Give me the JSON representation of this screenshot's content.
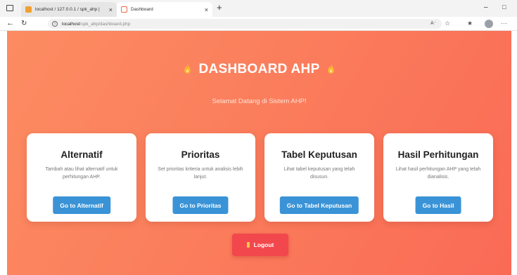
{
  "browser": {
    "tabs": [
      {
        "title": "localhost / 127.0.0.1 / spk_ahp | ",
        "active": false
      },
      {
        "title": "Dashboard",
        "active": true
      }
    ],
    "url_host": "localhost",
    "url_path": "/spk_ahp/dashboard.php",
    "new_tab_symbol": "+",
    "close_symbol": "×",
    "minimize_symbol": "–",
    "menu_symbol": "···"
  },
  "page": {
    "title": "DASHBOARD AHP",
    "subtitle": "Selamat Datang di Sistem AHP!",
    "cards": [
      {
        "title": "Alternatif",
        "desc": "Tambah atau lihat alternatif untuk perhitungan AHP.",
        "button": "Go to Alternatif"
      },
      {
        "title": "Prioritas",
        "desc": "Set prioritas kriteria untuk analisis lebih lanjut.",
        "button": "Go to Prioritas"
      },
      {
        "title": "Tabel Keputusan",
        "desc": "Lihat tabel keputusan yang telah disusun.",
        "button": "Go to Tabel Keputusan"
      },
      {
        "title": "Hasil Perhitungan",
        "desc": "Lihat hasil perhitungan AHP yang telah dianalisis.",
        "button": "Go to Hasil"
      }
    ],
    "logout_label": "Logout"
  },
  "colors": {
    "background_gradient": [
      "#fc8c62",
      "#fa6a56"
    ],
    "card_button": "#3a93d6",
    "logout_button": "#f2474c",
    "flame": "#f7b733"
  },
  "icons": [
    "window-icon",
    "phpmyadmin-favicon",
    "dashboard-favicon",
    "back-arrow-icon",
    "refresh-icon",
    "info-icon",
    "read-aloud-icon",
    "star-icon",
    "favorites-icon",
    "profile-avatar-icon",
    "flame-icon",
    "door-icon"
  ]
}
